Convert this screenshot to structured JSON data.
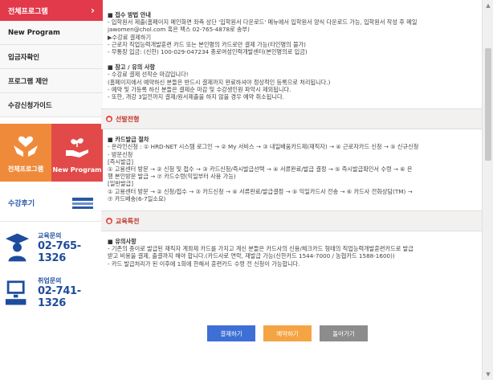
{
  "sidebar": {
    "active": "전체프로그램",
    "items": [
      "New Program",
      "입금자확인",
      "프로그램 제안",
      "수강신청가이드"
    ],
    "tiles": [
      {
        "label": "전체프로그램",
        "icon": "hands-heart-icon",
        "color": "#f08a3b"
      },
      {
        "label": "New Program",
        "icon": "hand-sprout-icon",
        "color": "#e24a4a"
      }
    ],
    "review": {
      "label": "수강후기",
      "icon": "keyboard-icon"
    },
    "contacts": [
      {
        "label": "교육문의",
        "number": "02-765-1326",
        "icon": "graduate-icon"
      },
      {
        "label": "취업문의",
        "number": "02-741-1326",
        "icon": "computer-icon"
      }
    ]
  },
  "main": {
    "block1": [
      "■ 접수 방법 안내",
      "- 입학원서 제출(홈페이지 메인화면 좌측 상단 '입학원서 다운로드' 메뉴에서 입학원서 양식 다운로드 가능, 입학원서 작성 후 메일",
      "jawomen@chol.com 혹은 팩스 02-765-4878로 송부)",
      "▶수강료 결제하기",
      "- 근로자 직업능력개발훈련 카드 또는 본인명의 카드로만 결제 가능(타인명의 불가)",
      "- 무통장 입금: (신한) 100-029-047234 종로여성인력개발센터(본인명의로 입금)"
    ],
    "block2": [
      "■ 참고 / 유의 사항",
      "- 수강료 결제 선착순 마감입니다!",
      "(홈페이지에서 예약하신 분들은 반드시 결제까지 완료하셔야 정상적인 등록으로 처리됩니다.)",
      "- 예약 및 가등록 하신 분들은 결제순 마감 및 수강생인원 파악시 제외됩니다.",
      "- 또한, 개강 3일전까지 결제/원서제출을 하지 않을 경우 예약 취소됩니다."
    ],
    "section1_title": "선발전형",
    "block3": [
      "■ 카드발급 절차",
      "- 온라인신청 : ① HRD-NET 시스템 로그인 → ② My 서비스 → ③ 내일배움카드제(재직자) → ④ 근로자카드 신청 → ⑤ 신규신청",
      "- 방문신청",
      "[즉시발급]",
      "① 고용센터 방문 → ② 신청 및 접수 → ③ 카드신청/즉시발급선택 → ④ 서류완료/발급 결정 → ⑤ 즉시발급확인서 수령 → ⑥ 은",
      "행 본인방문 발급 → ⑦ 카드수령(익일부터 사용 가능)",
      "[일반발급]",
      "① 고용센터 방문 → ② 신청/접수 → ③ 카드신청 → ④ 서류완료/발급결정 → ⑤ 익일카드사 전송 → ⑥ 카드사 전화상담(TM) →",
      "⑦ 카드배송(6-7일소요)"
    ],
    "section2_title": "교육특전",
    "block4": [
      "■ 유의사항",
      "- 기존의 종이로 발급된 재직자 계좌제 카드를 가지고 계신 분들은 카드사의 신용/체크카드 형태의 직업능력개발훈련카드로 발급",
      "받고 비용을 결제, 출결까지 해야 합니다.(카드사로 연락, 재발급 가능(신한카드 1544-7000 / 농협카드 1588-1600))",
      "- 카드 발급처리가 된 이후에 1회에 한해서 훈련카드 수령 전 신청이 가능합니다."
    ],
    "buttons": {
      "pay": "결제하기",
      "reserve": "예약하기",
      "back": "돌아가기"
    }
  },
  "colors": {
    "accent_red": "#e23a4b",
    "button_blue": "#3d6fd6",
    "button_orange": "#f5a443",
    "button_gray": "#8c8c8c",
    "contact_blue": "#1e4c9c"
  }
}
